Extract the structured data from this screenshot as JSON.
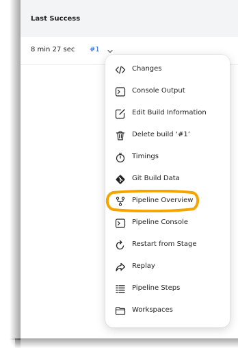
{
  "table": {
    "column_header": "Last Success",
    "duration": "8 min 27 sec",
    "build_link": "#1",
    "build_chevron_icon": "chevron-down-icon"
  },
  "menu": {
    "items": [
      {
        "label": "Changes",
        "icon": "code-icon"
      },
      {
        "label": "Console Output",
        "icon": "terminal-icon"
      },
      {
        "label": "Edit Build Information",
        "icon": "edit-icon"
      },
      {
        "label": "Delete build ‘#1’",
        "icon": "trash-icon"
      },
      {
        "label": "Timings",
        "icon": "stopwatch-icon"
      },
      {
        "label": "Git Build Data",
        "icon": "git-icon"
      },
      {
        "label": "Pipeline Overview",
        "icon": "fork-icon"
      },
      {
        "label": "Pipeline Console",
        "icon": "terminal-icon"
      },
      {
        "label": "Restart from Stage",
        "icon": "restart-icon"
      },
      {
        "label": "Replay",
        "icon": "replay-icon"
      },
      {
        "label": "Pipeline Steps",
        "icon": "list-icon"
      },
      {
        "label": "Workspaces",
        "icon": "folder-icon"
      }
    ]
  },
  "colors": {
    "link": "#1f66c8",
    "highlight_annotation": "#f5a400",
    "header_background": "#f3f4f6"
  }
}
